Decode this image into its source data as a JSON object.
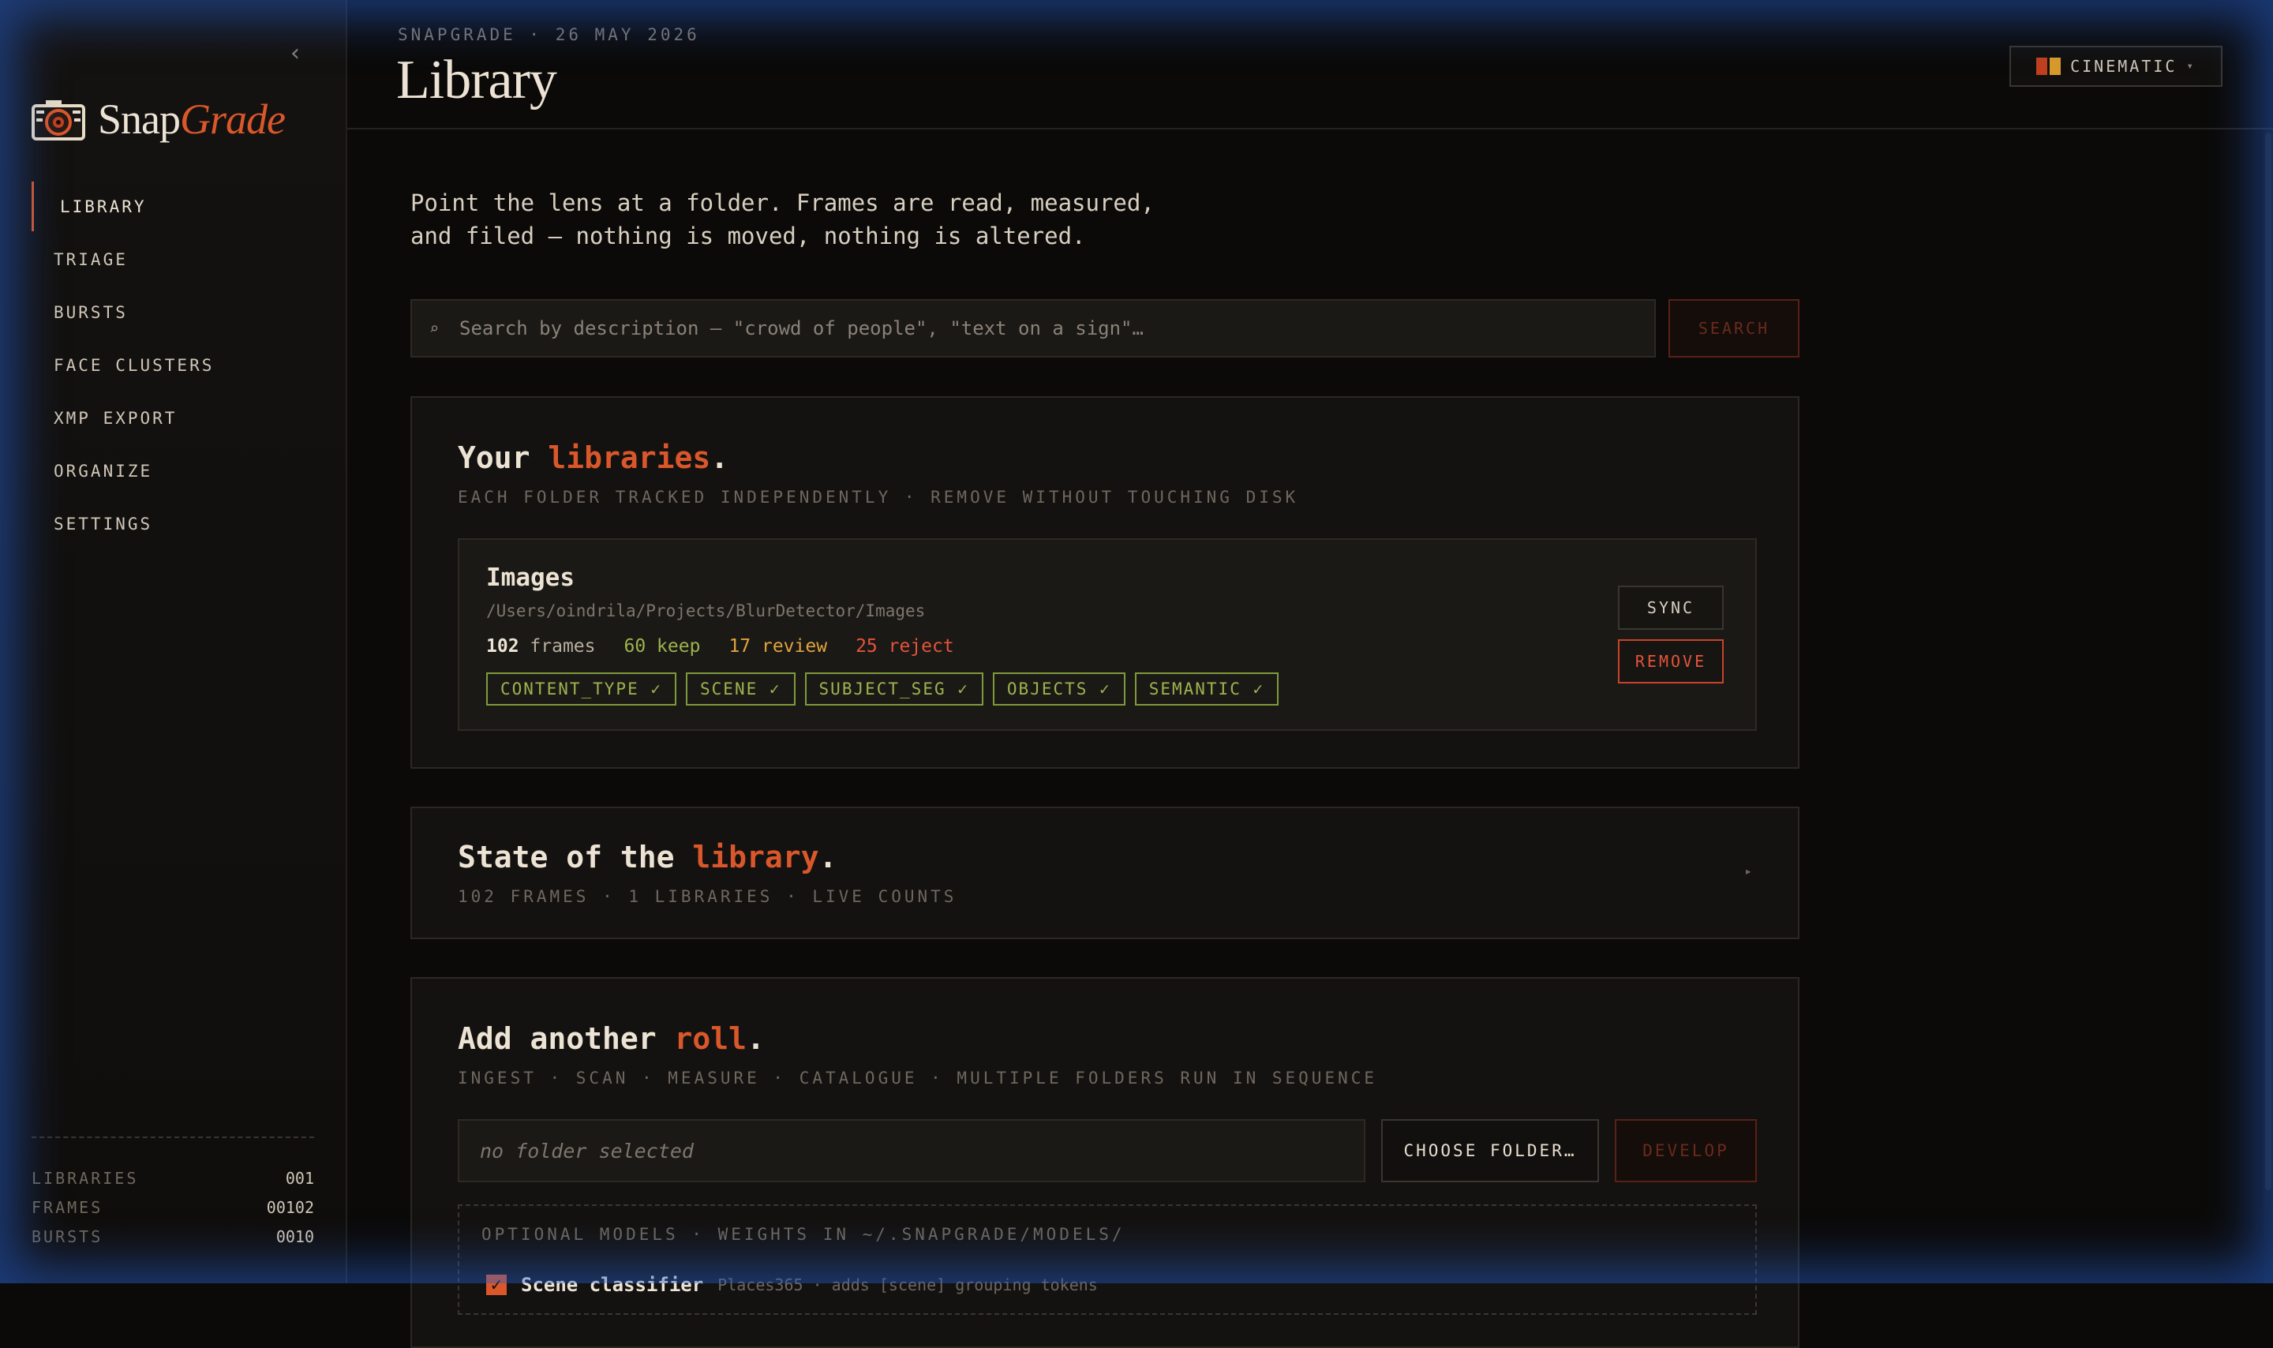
{
  "app": {
    "brand_prefix": "Snap",
    "brand_suffix": "Grade",
    "collapse_glyph": "‹"
  },
  "sidebar": {
    "items": [
      {
        "label": "LIBRARY",
        "active": true
      },
      {
        "label": "TRIAGE"
      },
      {
        "label": "BURSTS"
      },
      {
        "label": "FACE CLUSTERS"
      },
      {
        "label": "XMP EXPORT"
      },
      {
        "label": "ORGANIZE"
      },
      {
        "label": "SETTINGS"
      }
    ],
    "stats": [
      {
        "label": "LIBRARIES",
        "value": "001"
      },
      {
        "label": "FRAMES",
        "value": "00102"
      },
      {
        "label": "BURSTS",
        "value": "0010"
      }
    ]
  },
  "header": {
    "eyebrow": "SNAPGRADE · 26 MAY 2026",
    "title": "Library",
    "theme_label": "CINEMATIC",
    "theme_caret": "▾"
  },
  "intro": {
    "line1": "Point the lens at a folder. Frames are read, measured,",
    "line2": "and filed — nothing is moved, nothing is altered."
  },
  "search": {
    "icon": "⌕",
    "placeholder": "Search by description — \"crowd of people\", \"text on a sign\"…",
    "value": "",
    "button": "SEARCH"
  },
  "libraries_card": {
    "title_pre": "Your ",
    "title_accent": "libraries",
    "title_post": ".",
    "subtitle": "EACH FOLDER TRACKED INDEPENDENTLY · REMOVE WITHOUT TOUCHING DISK",
    "library": {
      "name": "Images",
      "path": "/Users/oindrila/Projects/BlurDetector/Images",
      "frames_count": "102",
      "frames_label": "frames",
      "keep": "60 keep",
      "review": "17 review",
      "reject": "25 reject",
      "tags": [
        "CONTENT_TYPE ✓",
        "SCENE ✓",
        "SUBJECT_SEG ✓",
        "OBJECTS ✓",
        "SEMANTIC ✓"
      ],
      "sync_label": "SYNC",
      "remove_label": "REMOVE"
    }
  },
  "state_card": {
    "title_pre": "State of the ",
    "title_accent": "library",
    "title_post": ".",
    "subtitle": "102 FRAMES · 1 LIBRARIES · LIVE COUNTS",
    "expand_glyph": "▸"
  },
  "add_card": {
    "title_pre": "Add another ",
    "title_accent": "roll",
    "title_post": ".",
    "subtitle": "INGEST · SCAN · MEASURE · CATALOGUE · MULTIPLE FOLDERS RUN IN SEQUENCE",
    "folder_value": "no folder selected",
    "choose_label": "CHOOSE FOLDER…",
    "develop_label": "DEVELOP",
    "models_heading": "OPTIONAL MODELS · WEIGHTS IN ~/.SNAPGRADE/MODELS/",
    "model": {
      "checked": true,
      "check_glyph": "✓",
      "name": "Scene classifier",
      "desc": "Places365 · adds [scene] grouping tokens"
    }
  },
  "colors": {
    "accent": "#d9572a",
    "keep": "#9db34e",
    "review": "#e0a33c",
    "reject": "#e5533a",
    "glow": "#2660d2",
    "theme_swatch": [
      "#c0401f",
      "#d99a2b"
    ]
  }
}
